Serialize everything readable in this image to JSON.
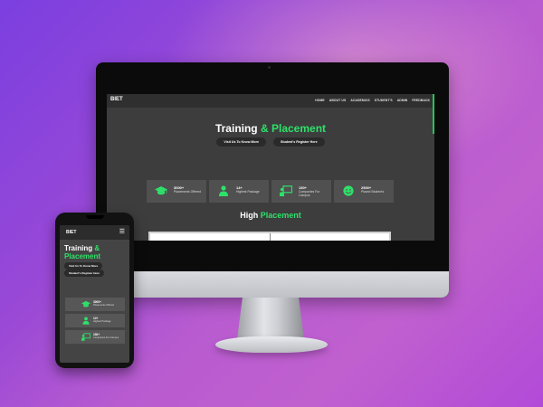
{
  "brand": "BIET",
  "colors": {
    "accent": "#2ee06a",
    "nav_bg": "#2f2f2f",
    "page_bg": "#3d3d3d"
  },
  "nav": {
    "items": [
      "HOME",
      "ABOUT US",
      "ACADEMICS",
      "STUDENT'S",
      "ADMIN",
      "FEEDBACK"
    ]
  },
  "hero": {
    "title_main": "Training",
    "title_accent": "& Placement",
    "btn_visit": "Visit Us To Know More",
    "btn_register": "Student's Register Here"
  },
  "stats": [
    {
      "icon": "graduation-cap-icon",
      "value": "3000+",
      "label": "Placements Offered"
    },
    {
      "icon": "person-icon",
      "value": "14+",
      "label": "Highest Package"
    },
    {
      "icon": "presentation-board-icon",
      "value": "150+",
      "label": "Companies For Campus"
    },
    {
      "icon": "smiley-face-icon",
      "value": "2500+",
      "label": "Placed Student's"
    }
  ],
  "section": {
    "title_main": "High",
    "title_accent": "Placement"
  },
  "mobile": {
    "menu_icon": "hamburger-menu-icon",
    "title_line1": "Training &",
    "title_line2": "Placement"
  }
}
